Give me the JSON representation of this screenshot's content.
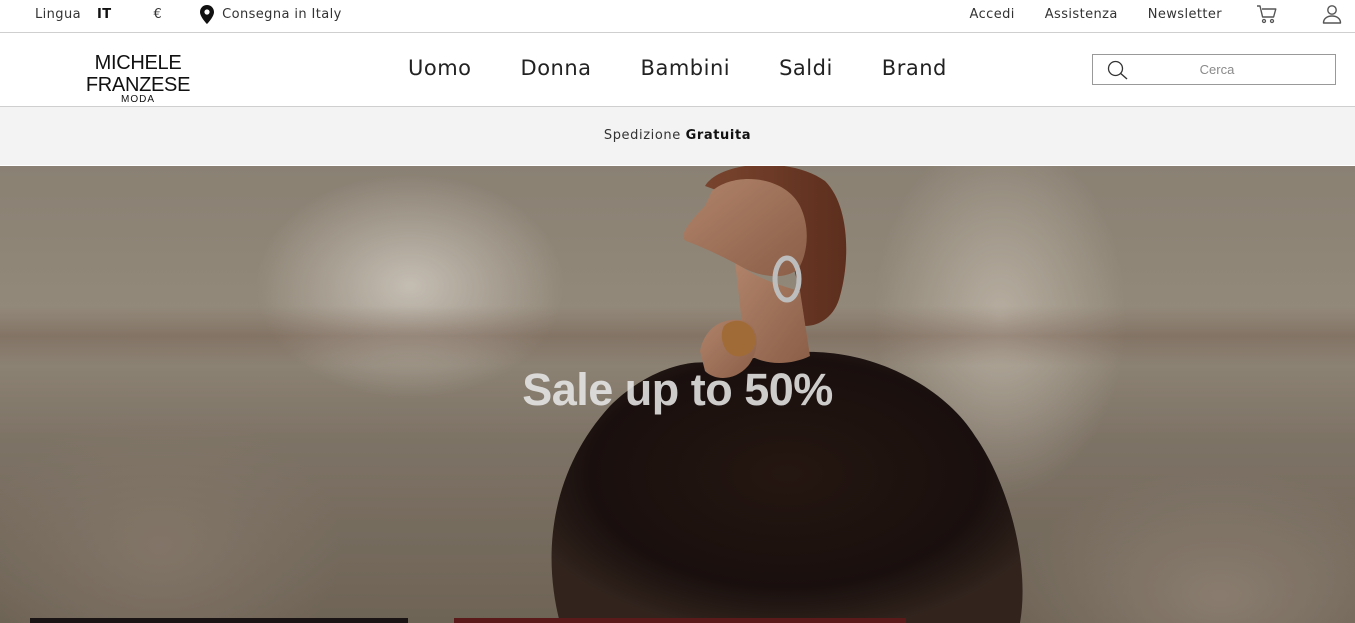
{
  "topbar": {
    "language_label": "Lingua",
    "language_value": "IT",
    "currency": "€",
    "delivery_text": "Consegna in Italy",
    "links": {
      "login": "Accedi",
      "support": "Assistenza",
      "newsletter": "Newsletter"
    },
    "icons": {
      "delivery": "location-pin-icon",
      "cart": "cart-icon",
      "account": "user-icon"
    }
  },
  "header": {
    "logo": {
      "brand": "MICHELE FRANZESE",
      "sub": "MODA"
    },
    "nav": [
      {
        "label": "Uomo"
      },
      {
        "label": "Donna"
      },
      {
        "label": "Bambini"
      },
      {
        "label": "Saldi"
      },
      {
        "label": "Brand"
      }
    ],
    "search": {
      "placeholder": "Cerca",
      "value": "",
      "icon": "search-icon"
    }
  },
  "promo": {
    "text": "Spedizione",
    "emphasis": "Gratuita"
  },
  "hero": {
    "headline": "Sale up to 50%"
  },
  "colors": {
    "promo_bg": "#f3f3f3",
    "text": "#222222",
    "border": "#cfcfcf"
  }
}
